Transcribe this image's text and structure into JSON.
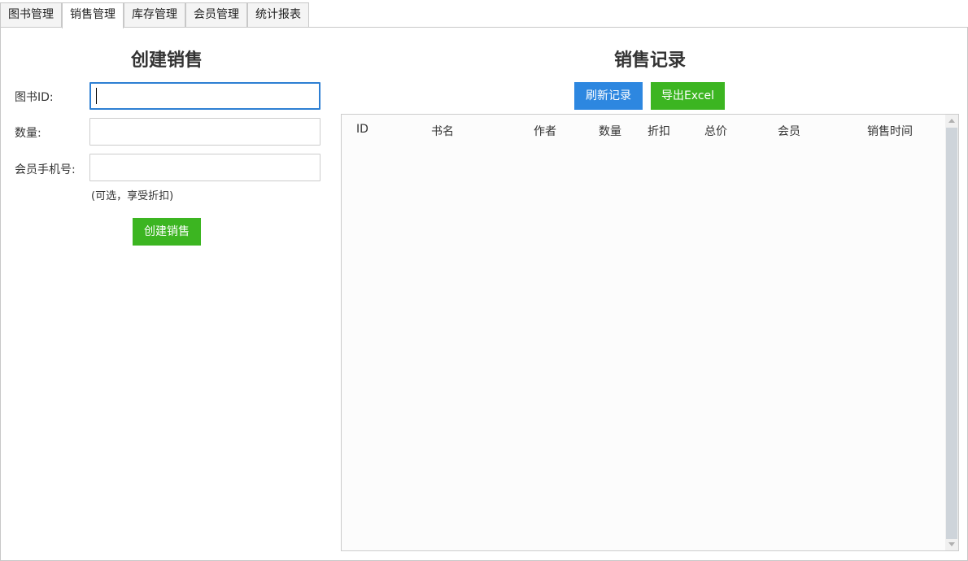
{
  "tabs": [
    {
      "label": "图书管理"
    },
    {
      "label": "销售管理"
    },
    {
      "label": "库存管理"
    },
    {
      "label": "会员管理"
    },
    {
      "label": "统计报表"
    }
  ],
  "create_sale": {
    "title": "创建销售",
    "book_id_label": "图书ID:",
    "book_id_value": "",
    "quantity_label": "数量:",
    "quantity_value": "",
    "phone_label": "会员手机号:",
    "phone_value": "",
    "phone_hint": "(可选，享受折扣)",
    "submit_label": "创建销售"
  },
  "sales_records": {
    "title": "销售记录",
    "refresh_label": "刷新记录",
    "export_label": "导出Excel",
    "columns": [
      "ID",
      "书名",
      "作者",
      "数量",
      "折扣",
      "总价",
      "会员",
      "销售时间"
    ],
    "rows": []
  },
  "colors": {
    "primary_blue": "#2d87e0",
    "success_green": "#3cb521",
    "focus_border": "#2d7fd3"
  }
}
